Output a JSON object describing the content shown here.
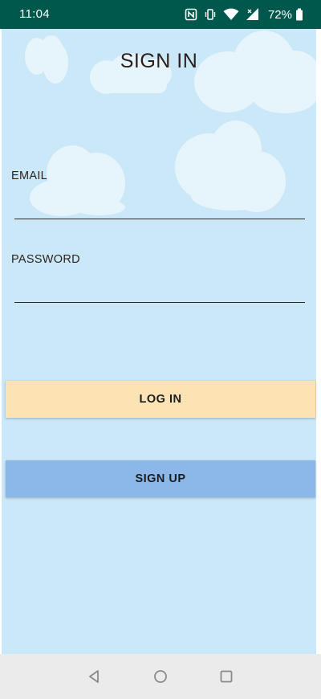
{
  "status_bar": {
    "time": "11:04",
    "battery_percent": "72%",
    "icons": [
      "nfc-icon",
      "vibrate-icon",
      "wifi-icon",
      "cell-signal-icon",
      "battery-icon"
    ]
  },
  "screen": {
    "title": "SIGN IN",
    "email_label": "EMAIL",
    "email_value": "",
    "password_label": "PASSWORD",
    "password_value": "",
    "login_button": "LOG IN",
    "signup_button": "SIGN UP"
  },
  "nav_bar": {
    "buttons": [
      "back-icon",
      "home-icon",
      "recents-icon"
    ]
  },
  "colors": {
    "status_bar": "#00574b",
    "sky": "#cbe8f8",
    "cloud": "#e6f4fb",
    "login_button": "#fde3b3",
    "signup_button": "#8bb8e8",
    "nav_bar": "#ebebeb"
  }
}
